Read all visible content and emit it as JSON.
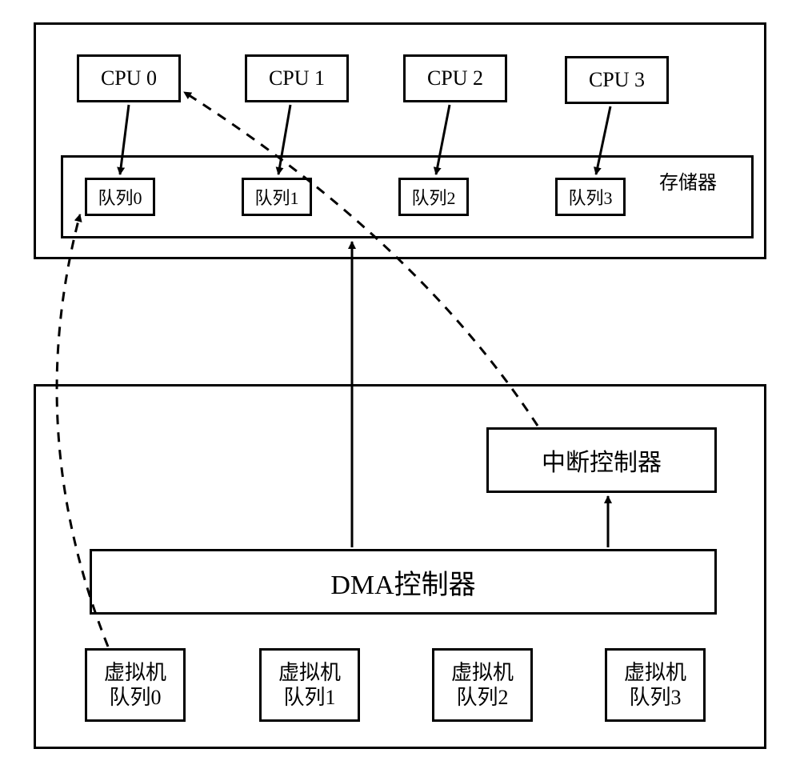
{
  "cpus": {
    "cpu0": "CPU 0",
    "cpu1": "CPU 1",
    "cpu2": "CPU 2",
    "cpu3": "CPU 3"
  },
  "queues": {
    "q0": "队列0",
    "q1": "队列1",
    "q2": "队列2",
    "q3": "队列3"
  },
  "memory_label": "存储器",
  "interrupt_controller": "中断控制器",
  "dma_controller": "DMA控制器",
  "vm_queues": {
    "vmq0": "虚拟机\n队列0",
    "vmq1": "虚拟机\n队列1",
    "vmq2": "虚拟机\n队列2",
    "vmq3": "虚拟机\n队列3"
  }
}
